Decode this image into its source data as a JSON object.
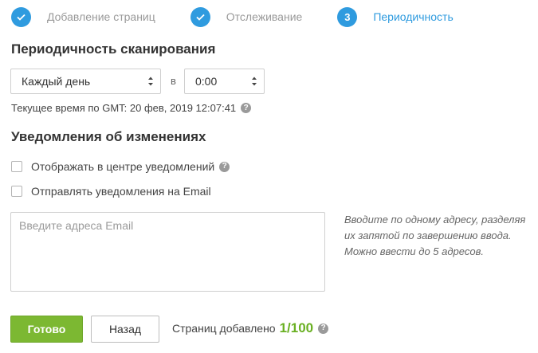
{
  "stepper": {
    "steps": [
      {
        "label": "Добавление страниц",
        "state": "completed",
        "icon": "check-icon"
      },
      {
        "label": "Отслеживание",
        "state": "completed",
        "icon": "check-icon"
      },
      {
        "label": "Периодичность",
        "state": "active",
        "number": "3"
      }
    ]
  },
  "scan": {
    "heading": "Периодичность сканирования",
    "frequency_value": "Каждый день",
    "separator": "в",
    "time_value": "0:00",
    "current_time": "Текущее время по GMT: 20 фев, 2019 12:07:41"
  },
  "notifications": {
    "heading": "Уведомления об изменениях",
    "notify_center_label": "Отображать в центре уведомлений",
    "email_label": "Отправлять уведомления на Email",
    "email_placeholder": "Введите адреса Email",
    "hint_lines": [
      "Вводите по одному адресу, разделяя",
      "их запятой по завершению ввода.",
      "Можно ввести до 5 адресов."
    ]
  },
  "footer": {
    "done_label": "Готово",
    "back_label": "Назад",
    "pages_added_label": "Страниц добавлено",
    "pages_count": "1/100"
  },
  "colors": {
    "accent": "#2f9bdf",
    "primary_button": "#7cb832",
    "count_green": "#6ab023"
  }
}
